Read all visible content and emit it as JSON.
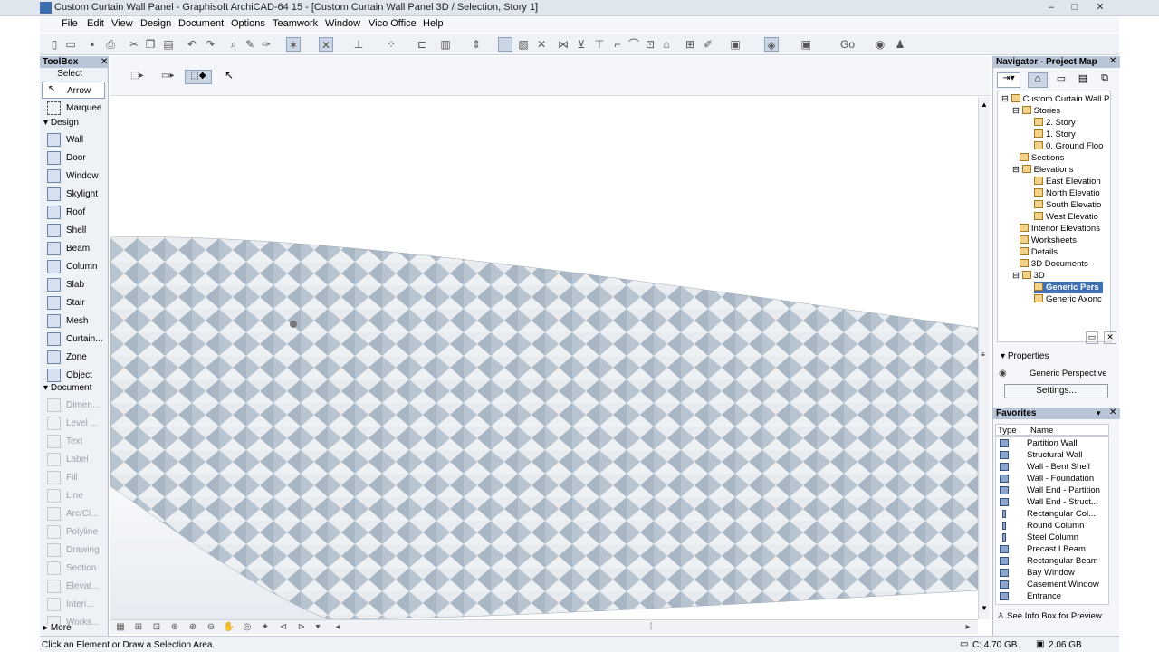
{
  "window": {
    "title": "Custom Curtain Wall Panel - Graphisoft ArchiCAD-64 15 - [Custom Curtain Wall Panel 3D / Selection, Story 1]",
    "controls": [
      "–",
      "□",
      "✕"
    ]
  },
  "menubar": [
    "File",
    "Edit",
    "View",
    "Design",
    "Document",
    "Options",
    "Teamwork",
    "Window",
    "Vico Office",
    "Help"
  ],
  "toolbar": {
    "go_label": "Go"
  },
  "toolbox": {
    "title": "ToolBox",
    "select_label": "Select",
    "arrow": "Arrow",
    "marquee": "Marquee",
    "design_section": "Design",
    "design_tools": [
      "Wall",
      "Door",
      "Window",
      "Skylight",
      "Roof",
      "Shell",
      "Beam",
      "Column",
      "Slab",
      "Stair",
      "Mesh",
      "Curtain...",
      "Zone",
      "Object"
    ],
    "document_section": "Document",
    "document_tools": [
      "Dimen...",
      "Level ...",
      "Text",
      "Label",
      "Fill",
      "Line",
      "Arc/Ci...",
      "Polyline",
      "Drawing",
      "Section",
      "Elevat...",
      "Interi...",
      "Works..."
    ],
    "more": "More"
  },
  "navigator": {
    "title": "Navigator - Project Map",
    "tree": [
      {
        "label": "Custom Curtain Wall P",
        "level": 0
      },
      {
        "label": "Stories",
        "level": 1
      },
      {
        "label": "2. Story",
        "level": 2
      },
      {
        "label": "1. Story",
        "level": 2
      },
      {
        "label": "0. Ground Floo",
        "level": 2
      },
      {
        "label": "Sections",
        "level": 1
      },
      {
        "label": "Elevations",
        "level": 1
      },
      {
        "label": "East Elevation",
        "level": 2
      },
      {
        "label": "North Elevatio",
        "level": 2
      },
      {
        "label": "South Elevatio",
        "level": 2
      },
      {
        "label": "West Elevatio",
        "level": 2
      },
      {
        "label": "Interior Elevations",
        "level": 1
      },
      {
        "label": "Worksheets",
        "level": 1
      },
      {
        "label": "Details",
        "level": 1
      },
      {
        "label": "3D Documents",
        "level": 1
      },
      {
        "label": "3D",
        "level": 1
      },
      {
        "label": "Generic Pers",
        "level": 2,
        "selected": true
      },
      {
        "label": "Generic Axonc",
        "level": 2
      }
    ],
    "properties_label": "Properties",
    "properties_value": "Generic Perspective",
    "settings_label": "Settings..."
  },
  "favorites": {
    "title": "Favorites",
    "col_type": "Type",
    "col_name": "Name",
    "items": [
      "Partition Wall",
      "Structural Wall",
      "Wall - Bent Shell",
      "Wall - Foundation",
      "Wall End - Partition",
      "Wall End - Struct...",
      "Rectangular Col...",
      "Round Column",
      "Steel Column",
      "Precast I Beam",
      "Rectangular Beam",
      "Bay Window",
      "Casement Window",
      "Entrance"
    ],
    "footer": "See Info Box for Preview"
  },
  "status": {
    "message": "Click an Element or Draw a Selection Area.",
    "disk": "C: 4.70 GB",
    "memory": "2.06 GB"
  },
  "colors": {
    "panel_header": "#b8c6d8",
    "selection": "#3f6fb5"
  }
}
